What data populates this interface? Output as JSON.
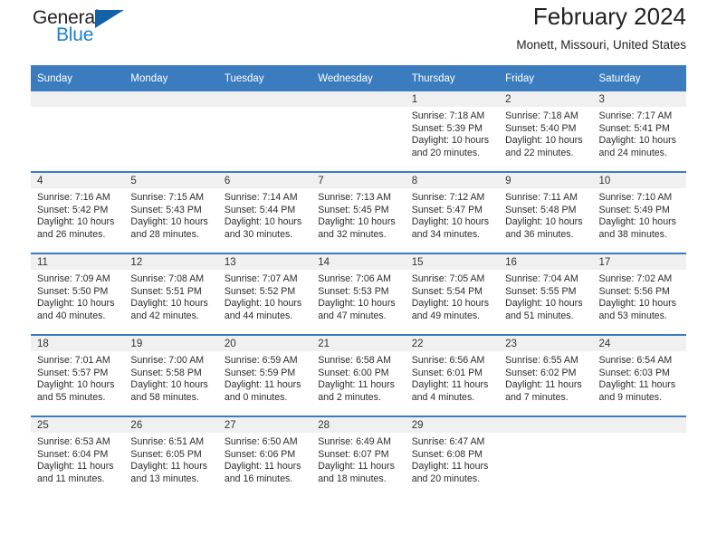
{
  "logo": {
    "word_top": "General",
    "word_bottom": "Blue",
    "accent_color": "#1361a8",
    "text_color": "#231f20",
    "blue_text_color": "#1b7fd4"
  },
  "header": {
    "title": "February 2024",
    "subtitle": "Monett, Missouri, United States"
  },
  "theme": {
    "header_bar": "#3b7cbf",
    "daynum_band": "#f0f0f0",
    "row_divider": "#3b7cbf",
    "cell_background": "#ffffff"
  },
  "weekdays": [
    "Sunday",
    "Monday",
    "Tuesday",
    "Wednesday",
    "Thursday",
    "Friday",
    "Saturday"
  ],
  "labels": {
    "sunrise_prefix": "Sunrise:",
    "sunset_prefix": "Sunset:",
    "daylight_prefix": "Daylight:"
  },
  "weeks": [
    [
      {
        "day": "",
        "sunrise": "",
        "sunset": "",
        "daylight": ""
      },
      {
        "day": "",
        "sunrise": "",
        "sunset": "",
        "daylight": ""
      },
      {
        "day": "",
        "sunrise": "",
        "sunset": "",
        "daylight": ""
      },
      {
        "day": "",
        "sunrise": "",
        "sunset": "",
        "daylight": ""
      },
      {
        "day": "1",
        "sunrise": "Sunrise: 7:18 AM",
        "sunset": "Sunset: 5:39 PM",
        "daylight": "Daylight: 10 hours and 20 minutes."
      },
      {
        "day": "2",
        "sunrise": "Sunrise: 7:18 AM",
        "sunset": "Sunset: 5:40 PM",
        "daylight": "Daylight: 10 hours and 22 minutes."
      },
      {
        "day": "3",
        "sunrise": "Sunrise: 7:17 AM",
        "sunset": "Sunset: 5:41 PM",
        "daylight": "Daylight: 10 hours and 24 minutes."
      }
    ],
    [
      {
        "day": "4",
        "sunrise": "Sunrise: 7:16 AM",
        "sunset": "Sunset: 5:42 PM",
        "daylight": "Daylight: 10 hours and 26 minutes."
      },
      {
        "day": "5",
        "sunrise": "Sunrise: 7:15 AM",
        "sunset": "Sunset: 5:43 PM",
        "daylight": "Daylight: 10 hours and 28 minutes."
      },
      {
        "day": "6",
        "sunrise": "Sunrise: 7:14 AM",
        "sunset": "Sunset: 5:44 PM",
        "daylight": "Daylight: 10 hours and 30 minutes."
      },
      {
        "day": "7",
        "sunrise": "Sunrise: 7:13 AM",
        "sunset": "Sunset: 5:45 PM",
        "daylight": "Daylight: 10 hours and 32 minutes."
      },
      {
        "day": "8",
        "sunrise": "Sunrise: 7:12 AM",
        "sunset": "Sunset: 5:47 PM",
        "daylight": "Daylight: 10 hours and 34 minutes."
      },
      {
        "day": "9",
        "sunrise": "Sunrise: 7:11 AM",
        "sunset": "Sunset: 5:48 PM",
        "daylight": "Daylight: 10 hours and 36 minutes."
      },
      {
        "day": "10",
        "sunrise": "Sunrise: 7:10 AM",
        "sunset": "Sunset: 5:49 PM",
        "daylight": "Daylight: 10 hours and 38 minutes."
      }
    ],
    [
      {
        "day": "11",
        "sunrise": "Sunrise: 7:09 AM",
        "sunset": "Sunset: 5:50 PM",
        "daylight": "Daylight: 10 hours and 40 minutes."
      },
      {
        "day": "12",
        "sunrise": "Sunrise: 7:08 AM",
        "sunset": "Sunset: 5:51 PM",
        "daylight": "Daylight: 10 hours and 42 minutes."
      },
      {
        "day": "13",
        "sunrise": "Sunrise: 7:07 AM",
        "sunset": "Sunset: 5:52 PM",
        "daylight": "Daylight: 10 hours and 44 minutes."
      },
      {
        "day": "14",
        "sunrise": "Sunrise: 7:06 AM",
        "sunset": "Sunset: 5:53 PM",
        "daylight": "Daylight: 10 hours and 47 minutes."
      },
      {
        "day": "15",
        "sunrise": "Sunrise: 7:05 AM",
        "sunset": "Sunset: 5:54 PM",
        "daylight": "Daylight: 10 hours and 49 minutes."
      },
      {
        "day": "16",
        "sunrise": "Sunrise: 7:04 AM",
        "sunset": "Sunset: 5:55 PM",
        "daylight": "Daylight: 10 hours and 51 minutes."
      },
      {
        "day": "17",
        "sunrise": "Sunrise: 7:02 AM",
        "sunset": "Sunset: 5:56 PM",
        "daylight": "Daylight: 10 hours and 53 minutes."
      }
    ],
    [
      {
        "day": "18",
        "sunrise": "Sunrise: 7:01 AM",
        "sunset": "Sunset: 5:57 PM",
        "daylight": "Daylight: 10 hours and 55 minutes."
      },
      {
        "day": "19",
        "sunrise": "Sunrise: 7:00 AM",
        "sunset": "Sunset: 5:58 PM",
        "daylight": "Daylight: 10 hours and 58 minutes."
      },
      {
        "day": "20",
        "sunrise": "Sunrise: 6:59 AM",
        "sunset": "Sunset: 5:59 PM",
        "daylight": "Daylight: 11 hours and 0 minutes."
      },
      {
        "day": "21",
        "sunrise": "Sunrise: 6:58 AM",
        "sunset": "Sunset: 6:00 PM",
        "daylight": "Daylight: 11 hours and 2 minutes."
      },
      {
        "day": "22",
        "sunrise": "Sunrise: 6:56 AM",
        "sunset": "Sunset: 6:01 PM",
        "daylight": "Daylight: 11 hours and 4 minutes."
      },
      {
        "day": "23",
        "sunrise": "Sunrise: 6:55 AM",
        "sunset": "Sunset: 6:02 PM",
        "daylight": "Daylight: 11 hours and 7 minutes."
      },
      {
        "day": "24",
        "sunrise": "Sunrise: 6:54 AM",
        "sunset": "Sunset: 6:03 PM",
        "daylight": "Daylight: 11 hours and 9 minutes."
      }
    ],
    [
      {
        "day": "25",
        "sunrise": "Sunrise: 6:53 AM",
        "sunset": "Sunset: 6:04 PM",
        "daylight": "Daylight: 11 hours and 11 minutes."
      },
      {
        "day": "26",
        "sunrise": "Sunrise: 6:51 AM",
        "sunset": "Sunset: 6:05 PM",
        "daylight": "Daylight: 11 hours and 13 minutes."
      },
      {
        "day": "27",
        "sunrise": "Sunrise: 6:50 AM",
        "sunset": "Sunset: 6:06 PM",
        "daylight": "Daylight: 11 hours and 16 minutes."
      },
      {
        "day": "28",
        "sunrise": "Sunrise: 6:49 AM",
        "sunset": "Sunset: 6:07 PM",
        "daylight": "Daylight: 11 hours and 18 minutes."
      },
      {
        "day": "29",
        "sunrise": "Sunrise: 6:47 AM",
        "sunset": "Sunset: 6:08 PM",
        "daylight": "Daylight: 11 hours and 20 minutes."
      },
      {
        "day": "",
        "sunrise": "",
        "sunset": "",
        "daylight": ""
      },
      {
        "day": "",
        "sunrise": "",
        "sunset": "",
        "daylight": ""
      }
    ]
  ]
}
